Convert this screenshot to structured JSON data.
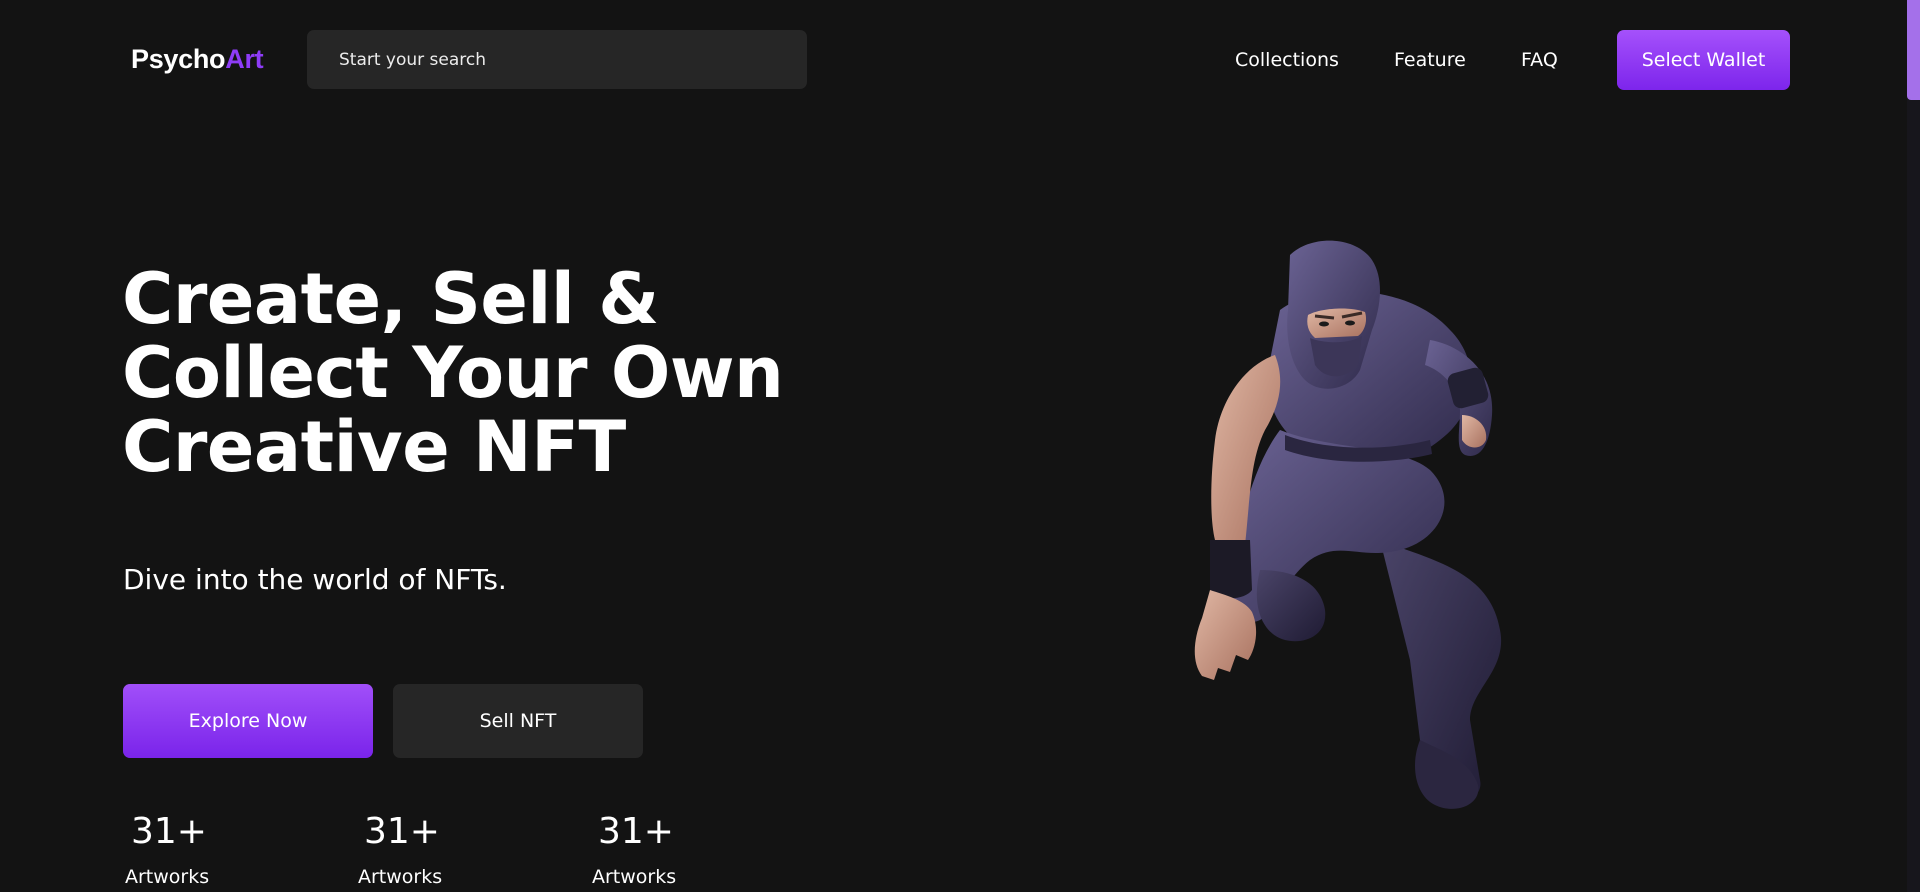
{
  "header": {
    "logo_part1": "Psycho",
    "logo_part2": "Art",
    "search_placeholder": "Start your search",
    "nav": [
      "Collections",
      "Feature",
      "FAQ"
    ],
    "wallet_label": "Select Wallet"
  },
  "hero": {
    "title_lines": [
      "Create, Sell &",
      "Collect Your Own",
      "Creative NFT"
    ],
    "subtitle": "Dive into the world of NFTs.",
    "explore_label": "Explore Now",
    "sell_label": "Sell NFT",
    "stats": [
      {
        "value": "31+",
        "label": "Artworks"
      },
      {
        "value": "31+",
        "label": "Artworks"
      },
      {
        "value": "31+",
        "label": "Artworks"
      }
    ]
  },
  "colors": {
    "background": "#131313",
    "accent": "#8e3cf7",
    "button_dark": "#262626"
  },
  "icons": {
    "hero_art": "ninja-figure-illustration"
  }
}
